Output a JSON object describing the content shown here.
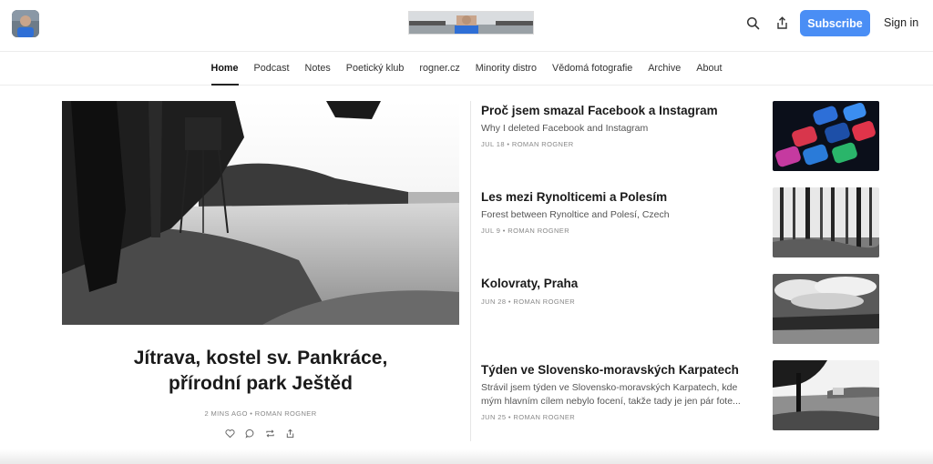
{
  "header": {
    "avatar_icon": "author-avatar",
    "banner_icon": "publication-banner",
    "search_icon": "search-icon",
    "share_icon": "share-icon",
    "subscribe_label": "Subscribe",
    "signin_label": "Sign in",
    "accent_color": "#4a8ef5"
  },
  "nav": {
    "items": [
      "Home",
      "Podcast",
      "Notes",
      "Poetický klub",
      "rogner.cz",
      "Minority distro",
      "Vědomá fotografie",
      "Archive",
      "About"
    ],
    "active": "Home"
  },
  "featured": {
    "title_line1": "Jítrava, kostel sv. Pankráce,",
    "title_line2": "přírodní park Ještěd",
    "meta": "2 MINS AGO • ROMAN ROGNER",
    "actions": [
      "heart-icon",
      "comment-icon",
      "restack-icon",
      "share-icon"
    ]
  },
  "posts": [
    {
      "title": "Proč jsem smazal Facebook a Instagram",
      "subtitle": "Why I deleted Facebook and Instagram",
      "meta": "JUL 18 • ROMAN ROGNER"
    },
    {
      "title": "Les mezi Rynolticemi a Polesím",
      "subtitle": "Forest between Rynoltice and Polesí, Czech",
      "meta": "JUL 9 • ROMAN ROGNER"
    },
    {
      "title": "Kolovraty, Praha",
      "subtitle": "",
      "meta": "JUN 28 • ROMAN ROGNER"
    },
    {
      "title": "Týden ve Slovensko-moravských Karpatech",
      "subtitle": "Strávil jsem týden ve Slovensko-moravských Karpatech, kde mým hlavním cílem nebylo focení, takže tady je jen pár fote...",
      "meta": "JUN 25 • ROMAN ROGNER"
    }
  ]
}
